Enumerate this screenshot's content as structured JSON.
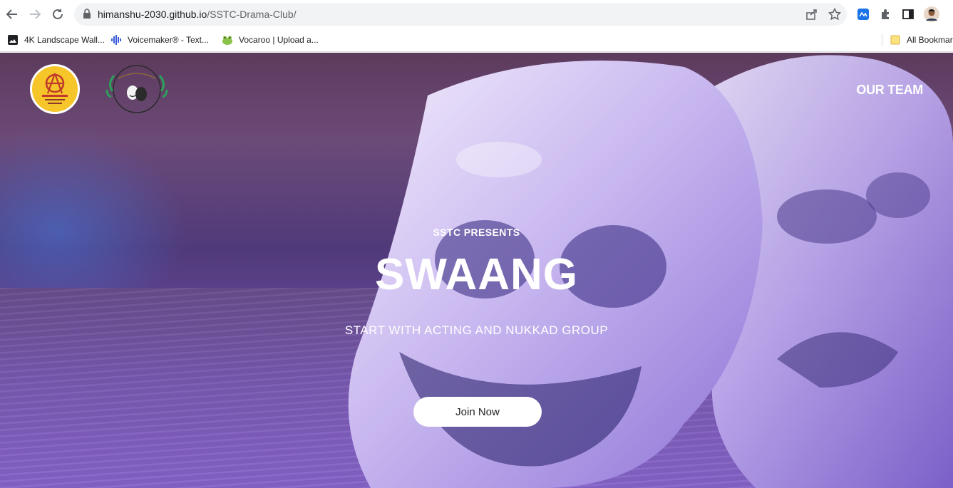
{
  "browser": {
    "url_host": "himanshu-2030.github.io",
    "url_path": "/SSTC-Drama-Club/",
    "bookmarks": [
      {
        "label": "4K Landscape Wall...",
        "icon": "image-icon"
      },
      {
        "label": "Voicemaker® - Text...",
        "icon": "audio-wave-icon"
      },
      {
        "label": "Vocaroo | Upload a...",
        "icon": "frog-icon"
      }
    ],
    "all_bookmarks_label": "All Bookmarks"
  },
  "page": {
    "nav": {
      "our_team": "OUR TEAM"
    },
    "hero": {
      "presents": "SSTC PRESENTS",
      "title": "SWAANG",
      "tagline": "START WITH ACTING AND NUKKAD GROUP",
      "cta": "Join Now"
    }
  },
  "colors": {
    "logo_yellow": "#f6c52a",
    "hero_purple": "#6a4aa0"
  }
}
